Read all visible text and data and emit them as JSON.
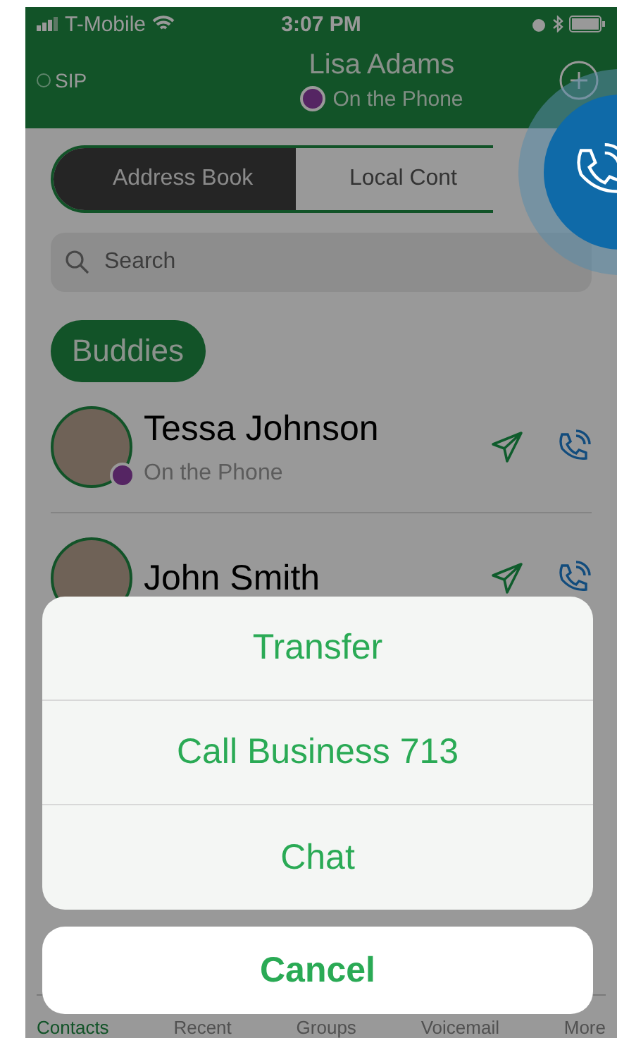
{
  "status_bar": {
    "carrier": "T-Mobile",
    "time": "3:07 PM"
  },
  "header": {
    "sip": "SIP",
    "name": "Lisa Adams",
    "status": "On the Phone"
  },
  "segments": [
    {
      "label": "Address Book",
      "selected": true
    },
    {
      "label": "Local Cont",
      "selected": false
    }
  ],
  "search": {
    "placeholder": "Search"
  },
  "section": "Buddies",
  "contacts": [
    {
      "name": "Tessa Johnson",
      "status": "On the Phone",
      "on_phone": true
    },
    {
      "name": "John Smith"
    }
  ],
  "tab_bar": [
    {
      "label": "Contacts",
      "selected": true
    },
    {
      "label": "Recent",
      "selected": false
    },
    {
      "label": "Groups",
      "selected": false
    },
    {
      "label": "Voicemail",
      "selected": false
    },
    {
      "label": "More",
      "selected": false
    }
  ],
  "action_sheet": {
    "actions": [
      "Transfer",
      "Call Business 713",
      "Chat"
    ],
    "cancel": "Cancel"
  }
}
